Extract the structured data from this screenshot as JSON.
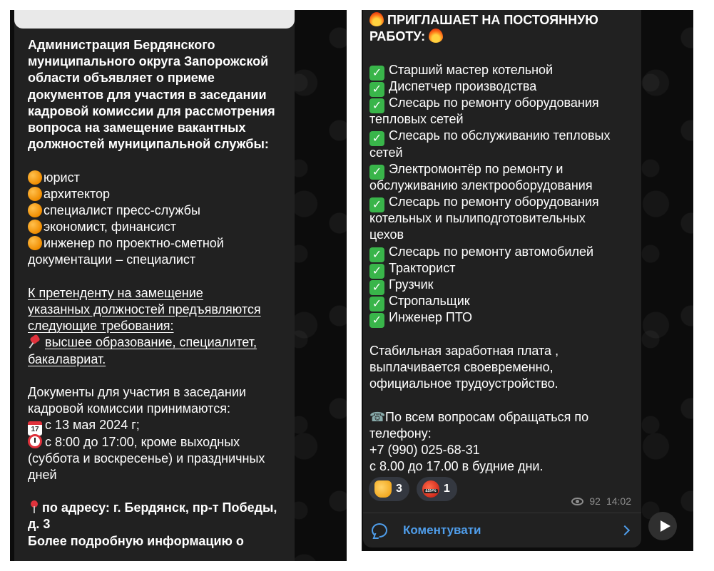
{
  "left_post": {
    "heading_lines": [
      "Администрация Бердянского",
      "муниципального округа Запорожской",
      "области  объявляет о приеме",
      "документов для участия в заседании",
      "кадровой комиссии для рассмотрения",
      "вопроса на замещение вакантных",
      "должностей муниципальной службы:"
    ],
    "positions": [
      "юрист",
      "архитектор",
      "специалист пресс-службы",
      "экономист, финансист",
      "инженер по проектно-сметной"
    ],
    "positions_tail": "документации – специалист",
    "requirements_lines": [
      "К претенденту на замещение",
      "указанных должностей предъявляются",
      "следующие требования:"
    ],
    "education_lines": [
      "высшее образование, специалитет,",
      "бакалавриат."
    ],
    "docs_lines": [
      "Документы для участия в заседании",
      "кадровой комиссии принимаются:"
    ],
    "calendar_day": "17",
    "date_text": "с 13 мая 2024 г;",
    "time_text": "с 8:00 до 17:00, кроме выходных",
    "time_lines": [
      "(суббота и воскресенье) и праздничных",
      "дней"
    ],
    "address_text": "по адресу: г. Бердянск, пр-т Победы,",
    "address_tail": "д. 3",
    "more_info": "Более подробную информацию о"
  },
  "right_post": {
    "headline_lines": [
      "ПРИГЛАШАЕТ НА ПОСТОЯННУЮ",
      "РАБОТУ:"
    ],
    "jobs": [
      {
        "lines": [
          "Старший мастер котельной"
        ]
      },
      {
        "lines": [
          "Диспетчер производства"
        ]
      },
      {
        "lines": [
          "Слесарь по ремонту оборудования",
          "тепловых сетей"
        ]
      },
      {
        "lines": [
          "Слесарь по обслуживанию тепловых",
          "сетей"
        ]
      },
      {
        "lines": [
          "Электромонтёр по ремонту и",
          "обслуживанию электрооборудования"
        ]
      },
      {
        "lines": [
          "Слесарь по ремонту оборудования",
          "котельных и пылиподготовительных",
          "цехов"
        ]
      },
      {
        "lines": [
          "Слесарь по ремонту автомобилей"
        ]
      },
      {
        "lines": [
          "Тракторист"
        ]
      },
      {
        "lines": [
          "Грузчик"
        ]
      },
      {
        "lines": [
          "Стропальщик"
        ]
      },
      {
        "lines": [
          "Инженер ПТО"
        ]
      }
    ],
    "salary_lines": [
      "Стабильная заработная плата ,",
      "выплачивается своевременно,",
      "официальное трудоустройство."
    ],
    "contact_lines": [
      "По всем вопросам обращаться по",
      "телефону:"
    ],
    "phone": "+7 (990) 025-68-31",
    "hours": "с 8.00 до 17.00 в будние дни.",
    "reactions": [
      {
        "emoji": "thumbs-up-emoji",
        "count": "3"
      },
      {
        "emoji": "angry-face-emoji",
        "count": "1",
        "mark": "&$!#%"
      }
    ],
    "views": "92",
    "time": "14:02",
    "comment_label": "Коментувати",
    "colors": {
      "accent": "#4f9dea",
      "bubble": "#212121",
      "background": "#0c0c0c"
    }
  }
}
